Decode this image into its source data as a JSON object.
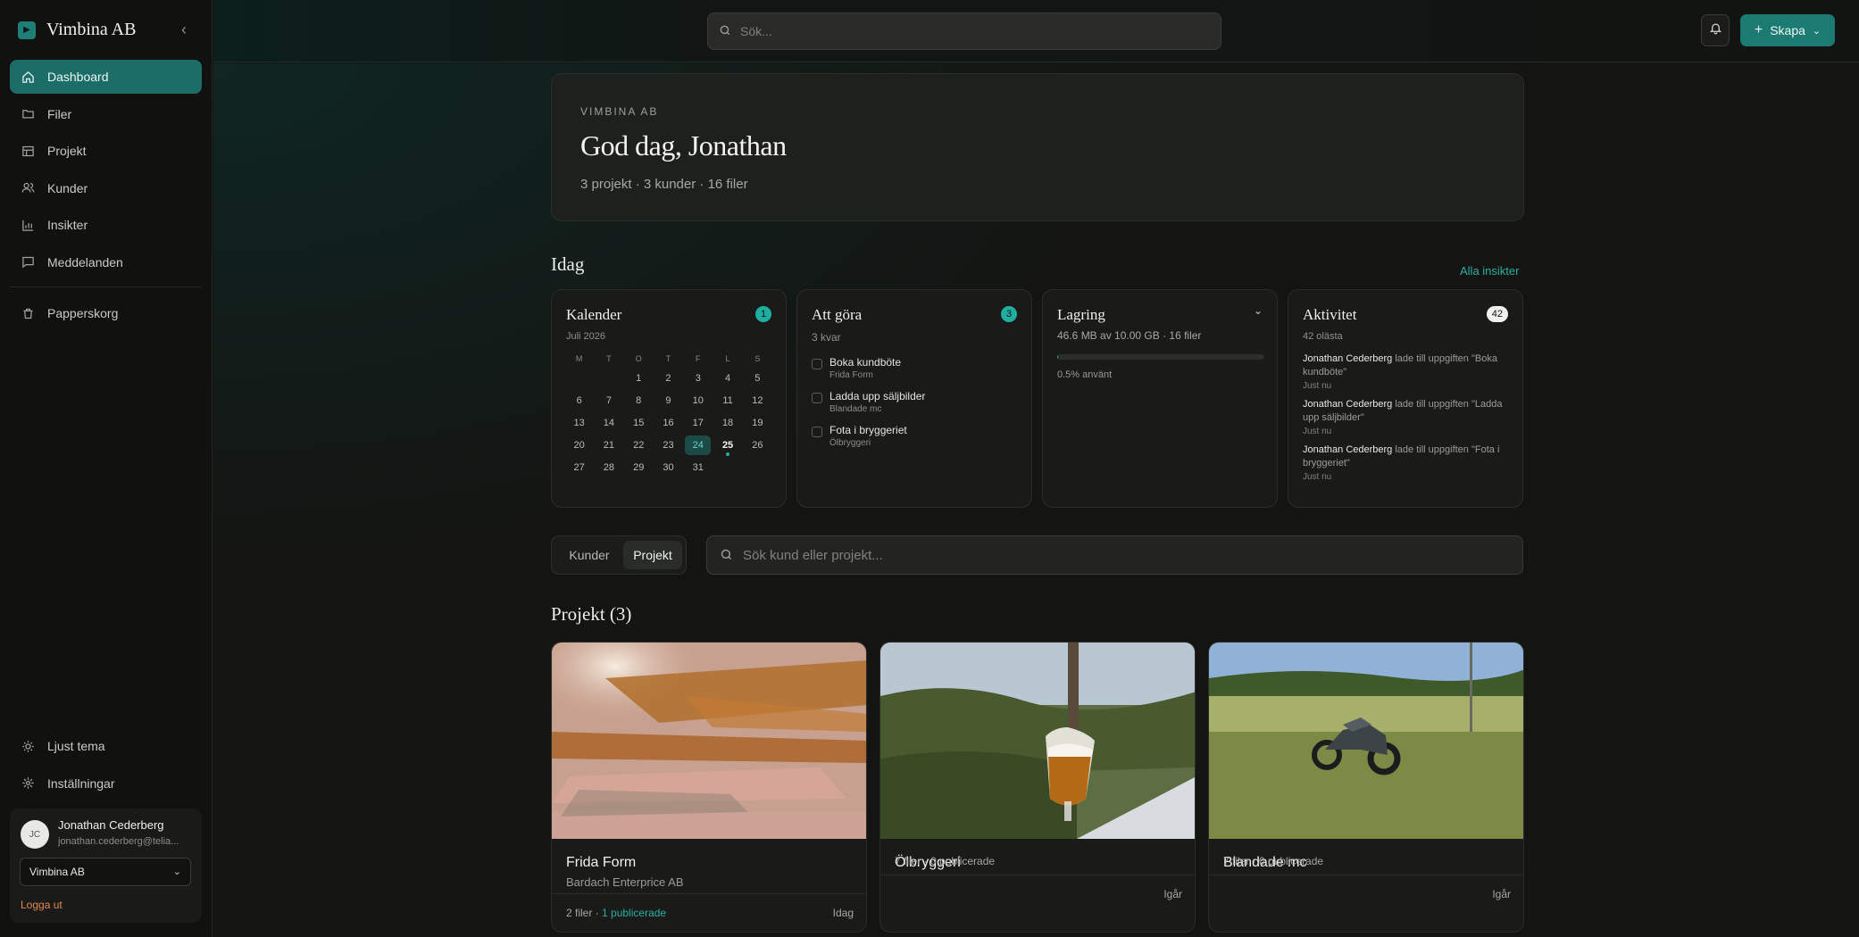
{
  "brand": {
    "name": "Vimbina AB"
  },
  "sidebar": {
    "items": [
      {
        "label": "Dashboard",
        "icon": "home-icon",
        "active": true
      },
      {
        "label": "Filer",
        "icon": "folder-icon"
      },
      {
        "label": "Projekt",
        "icon": "layout-icon"
      },
      {
        "label": "Kunder",
        "icon": "users-icon"
      },
      {
        "label": "Insikter",
        "icon": "chart-icon"
      },
      {
        "label": "Meddelanden",
        "icon": "message-icon"
      }
    ],
    "trash": {
      "label": "Papperskorg",
      "icon": "trash-icon"
    },
    "theme": {
      "label": "Ljust tema",
      "icon": "sun-icon"
    },
    "settings": {
      "label": "Inställningar",
      "icon": "gear-icon"
    },
    "user": {
      "initials": "JC",
      "name": "Jonathan Cederberg",
      "email": "jonathan.cederberg@telia...",
      "org": "Vimbina AB",
      "logout": "Logga ut"
    }
  },
  "topbar": {
    "search_placeholder": "Sök...",
    "create_label": "Skapa"
  },
  "hero": {
    "eyebrow": "VIMBINA AB",
    "title": "God dag, Jonathan",
    "subtitle": "3 projekt · 3 kunder · 16 filer"
  },
  "today": {
    "title": "Idag",
    "link": "Alla insikter",
    "calendar": {
      "title": "Kalender",
      "month": "Juli 2026",
      "badge": "1",
      "weekdays": [
        "M",
        "T",
        "O",
        "T",
        "F",
        "L",
        "S"
      ],
      "weeks": [
        [
          "",
          "",
          "1",
          "2",
          "3",
          "4",
          "5"
        ],
        [
          "6",
          "7",
          "8",
          "9",
          "10",
          "11",
          "12"
        ],
        [
          "13",
          "14",
          "15",
          "16",
          "17",
          "18",
          "19"
        ],
        [
          "20",
          "21",
          "22",
          "23",
          "24",
          "25",
          "26"
        ],
        [
          "27",
          "28",
          "29",
          "30",
          "31",
          "",
          ""
        ]
      ],
      "today": "24",
      "marked": "25"
    },
    "todo": {
      "title": "Att göra",
      "remaining": "3 kvar",
      "badge": "3",
      "items": [
        {
          "title": "Boka kundböte",
          "project": "Frida Form"
        },
        {
          "title": "Ladda upp säljbilder",
          "project": "Blandade mc"
        },
        {
          "title": "Fota i bryggeriet",
          "project": "Ölbryggeri"
        }
      ]
    },
    "storage": {
      "title": "Lagring",
      "summary": "46.6 MB av 10.00 GB · 16 filer",
      "used_label": "0.5% använt",
      "used_fraction": 0.005
    },
    "activity": {
      "title": "Aktivitet",
      "unread": "42 olästa",
      "badge": "42",
      "items": [
        {
          "user": "Jonathan Cederberg",
          "text": " lade till uppgiften \"Boka kundböte\"",
          "time": "Just nu"
        },
        {
          "user": "Jonathan Cederberg",
          "text": " lade till uppgiften \"Ladda upp säljbilder\"",
          "time": "Just nu"
        },
        {
          "user": "Jonathan Cederberg",
          "text": " lade till uppgiften \"Fota i bryggeriet\"",
          "time": "Just nu"
        }
      ]
    }
  },
  "filter": {
    "tabs": [
      "Kunder",
      "Projekt"
    ],
    "active": "Projekt",
    "search_placeholder": "Sök kund eller projekt..."
  },
  "projects": {
    "title": "Projekt (3)",
    "items": [
      {
        "name": "Frida Form",
        "client": "Bardach Enterprice AB",
        "files": "2 filer · ",
        "published": "1 publicerade",
        "date": "Idag"
      },
      {
        "name": "Ölbryggeri",
        "client": "",
        "files": "7 filer · 0 publicerade",
        "published": "",
        "date": "Igår"
      },
      {
        "name": "Blandade mc",
        "client": "",
        "files": "7 filer · 0 publicerade",
        "published": "",
        "date": "Igår"
      }
    ]
  }
}
